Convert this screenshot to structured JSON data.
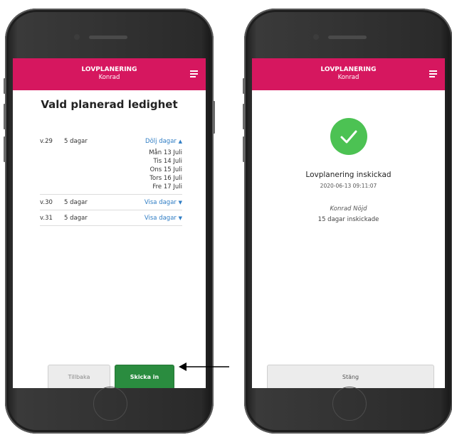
{
  "left_phone": {
    "header": {
      "title": "LOVPLANERING",
      "subtitle": "Konrad"
    },
    "page_title": "Vald planerad ledighet",
    "weeks": [
      {
        "week": "v.29",
        "days": "5 dagar",
        "toggle": "Dölj dagar",
        "toggle_icon": "triangle-up"
      },
      {
        "week": "v.30",
        "days": "5 dagar",
        "toggle": "Visa dagar",
        "toggle_icon": "triangle-down"
      },
      {
        "week": "v.31",
        "days": "5 dagar",
        "toggle": "Visa dagar",
        "toggle_icon": "triangle-down"
      }
    ],
    "expanded_days": [
      "Mån 13 Juli",
      "Tis 14 Juli",
      "Ons 15 Juli",
      "Tors 16 Juli",
      "Fre 17 Juli"
    ],
    "back_button": "Tillbaka",
    "send_button": "Skicka in"
  },
  "right_phone": {
    "header": {
      "title": "LOVPLANERING",
      "subtitle": "Konrad"
    },
    "status_title": "Lovplanering inskickad",
    "timestamp": "2020-06-13 09:11:07",
    "person_name": "Konrad Nöjd",
    "count_text": "15 dagar inskickade",
    "close_button": "Stäng",
    "success_icon": "check-icon"
  },
  "colors": {
    "header": "#d6175f",
    "primary_button": "#2a8c3f",
    "success": "#4cc253",
    "link": "#2f7dc4"
  },
  "annotation": {
    "arrow_icon": "arrow-left-icon"
  }
}
